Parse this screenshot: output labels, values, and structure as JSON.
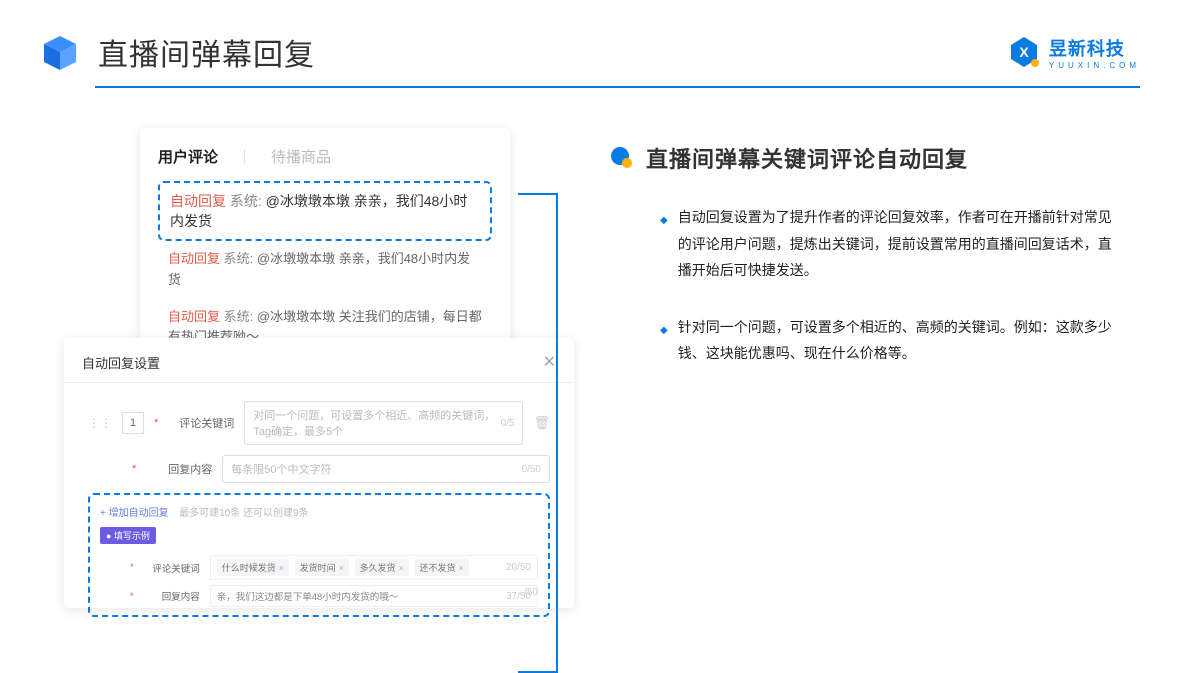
{
  "header": {
    "title": "直播间弹幕回复",
    "brand_cn": "昱新科技",
    "brand_en": "YUUXIN.COM"
  },
  "comments": {
    "tab_active": "用户评论",
    "tab_inactive": "待播商品",
    "items": [
      {
        "tag": "自动回复",
        "sys": "系统:",
        "text": "@冰墩墩本墩 亲亲，我们48小时内发货"
      },
      {
        "tag": "自动回复",
        "sys": "系统:",
        "text": "@冰墩墩本墩 亲亲，我们48小时内发货"
      },
      {
        "tag": "自动回复",
        "sys": "系统:",
        "text": "@冰墩墩本墩 关注我们的店铺，每日都有热门推荐呦～"
      }
    ]
  },
  "settings": {
    "title": "自动回复设置",
    "index": "1",
    "kw_label": "评论关键词",
    "kw_placeholder": "对同一个问题，可设置多个相近、高频的关键词，Tag确定，最多5个",
    "kw_counter": "0/5",
    "reply_label": "回复内容",
    "reply_placeholder": "每条限50个中文字符",
    "reply_counter": "0/50",
    "add_link": "+ 增加自动回复",
    "add_hint": "最多可建10条 还可以创建9条",
    "example_badge": "● 填写示例",
    "ex_kw_label": "评论关键词",
    "ex_tags": [
      "什么时候发货",
      "发货时间",
      "多久发货",
      "还不发货"
    ],
    "ex_kw_counter": "20/50",
    "ex_reply_label": "回复内容",
    "ex_reply_text": "亲，我们这边都是下单48小时内发货的哦～",
    "ex_reply_counter": "37/50",
    "overlay_counter": "/50"
  },
  "right": {
    "subtitle": "直播间弹幕关键词评论自动回复",
    "bullets": [
      "自动回复设置为了提升作者的评论回复效率，作者可在开播前针对常见的评论用户问题，提炼出关键词，提前设置常用的直播间回复话术，直播开始后可快捷发送。",
      "针对同一个问题，可设置多个相近的、高频的关键词。例如：这款多少钱、这块能优惠吗、现在什么价格等。"
    ]
  }
}
